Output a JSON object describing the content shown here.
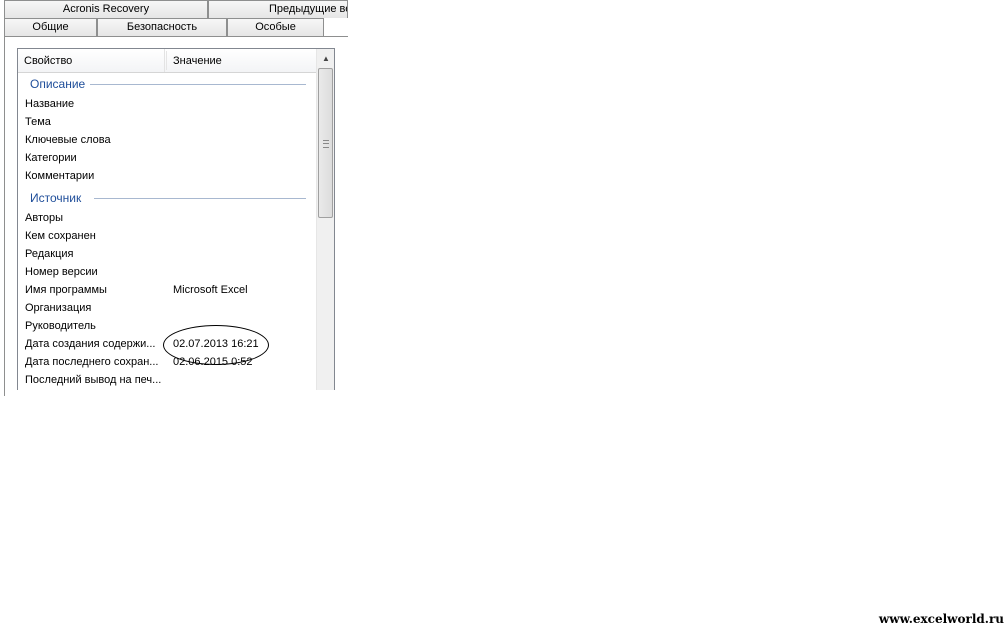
{
  "tabs": {
    "acronis": "Acronis Recovery",
    "previous": "Предыдущие ве",
    "general": "Общие",
    "security": "Безопасность",
    "custom": "Особые"
  },
  "list": {
    "header_property": "Свойство",
    "header_value": "Значение",
    "groups": {
      "description": "Описание",
      "source": "Источник"
    },
    "description_rows": [
      {
        "label": "Название",
        "value": ""
      },
      {
        "label": "Тема",
        "value": ""
      },
      {
        "label": "Ключевые слова",
        "value": ""
      },
      {
        "label": "Категории",
        "value": ""
      },
      {
        "label": "Комментарии",
        "value": ""
      }
    ],
    "source_rows": [
      {
        "label": "Авторы",
        "value": ""
      },
      {
        "label": "Кем сохранен",
        "value": ""
      },
      {
        "label": "Редакция",
        "value": ""
      },
      {
        "label": "Номер версии",
        "value": ""
      },
      {
        "label": "Имя программы",
        "value": "Microsoft Excel"
      },
      {
        "label": "Организация",
        "value": ""
      },
      {
        "label": "Руководитель",
        "value": ""
      },
      {
        "label": "Дата создания содержи...",
        "value": "02.07.2013 16:21"
      },
      {
        "label": "Дата последнего сохран...",
        "value": "02.06.2015 0:52"
      },
      {
        "label": "Последний вывод на печ...",
        "value": ""
      }
    ]
  },
  "watermark": "www.excelworld.ru",
  "icons": {
    "scroll_up": "▲"
  }
}
